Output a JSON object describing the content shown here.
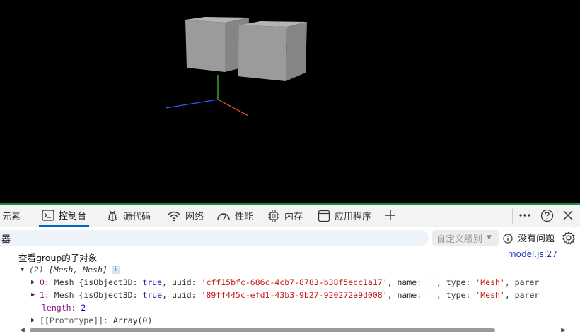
{
  "devtools": {
    "tabs": [
      {
        "label": "元素"
      },
      {
        "label": "控制台"
      },
      {
        "label": "源代码"
      },
      {
        "label": "网络"
      },
      {
        "label": "性能"
      },
      {
        "label": "内存"
      },
      {
        "label": "应用程序"
      }
    ],
    "more_icon": "plus-icon"
  },
  "filter": {
    "text": "器",
    "level": "自定义级别",
    "issues": "没有问题"
  },
  "console": {
    "message": "查看group的子对象",
    "source": "model.js:27",
    "array_summary": {
      "count": "(2)",
      "types": "[Mesh, Mesh]",
      "badge": "i"
    },
    "items": [
      {
        "index": "0:",
        "type": "Mesh",
        "open": " {isObject3D: ",
        "is3d": "true",
        "uuid_label": ", uuid: ",
        "uuid": "'cff15bfc-686c-4cb7-8783-b38f5ecc1a17'",
        "name_label": ", name: ",
        "name": "''",
        "type_label": ", type: ",
        "type_value": "'Mesh'",
        "tail": ", parer"
      },
      {
        "index": "1:",
        "type": "Mesh",
        "open": " {isObject3D: ",
        "is3d": "true",
        "uuid_label": ", uuid: ",
        "uuid": "'89ff445c-efd1-43b3-9b27-920272e9d008'",
        "name_label": ", name: ",
        "name": "''",
        "type_label": ", type: ",
        "type_value": "'Mesh'",
        "tail": ", parer"
      }
    ],
    "length_key": "length:",
    "length_value": "2",
    "prototype_key": "[[Prototype]]:",
    "prototype_value": "Array(0)"
  },
  "colors": {
    "viewport_bg": "#000000",
    "accent_green": "#1e8a3c",
    "active_tab": "#0067c0",
    "link": "#1a3bb3"
  }
}
